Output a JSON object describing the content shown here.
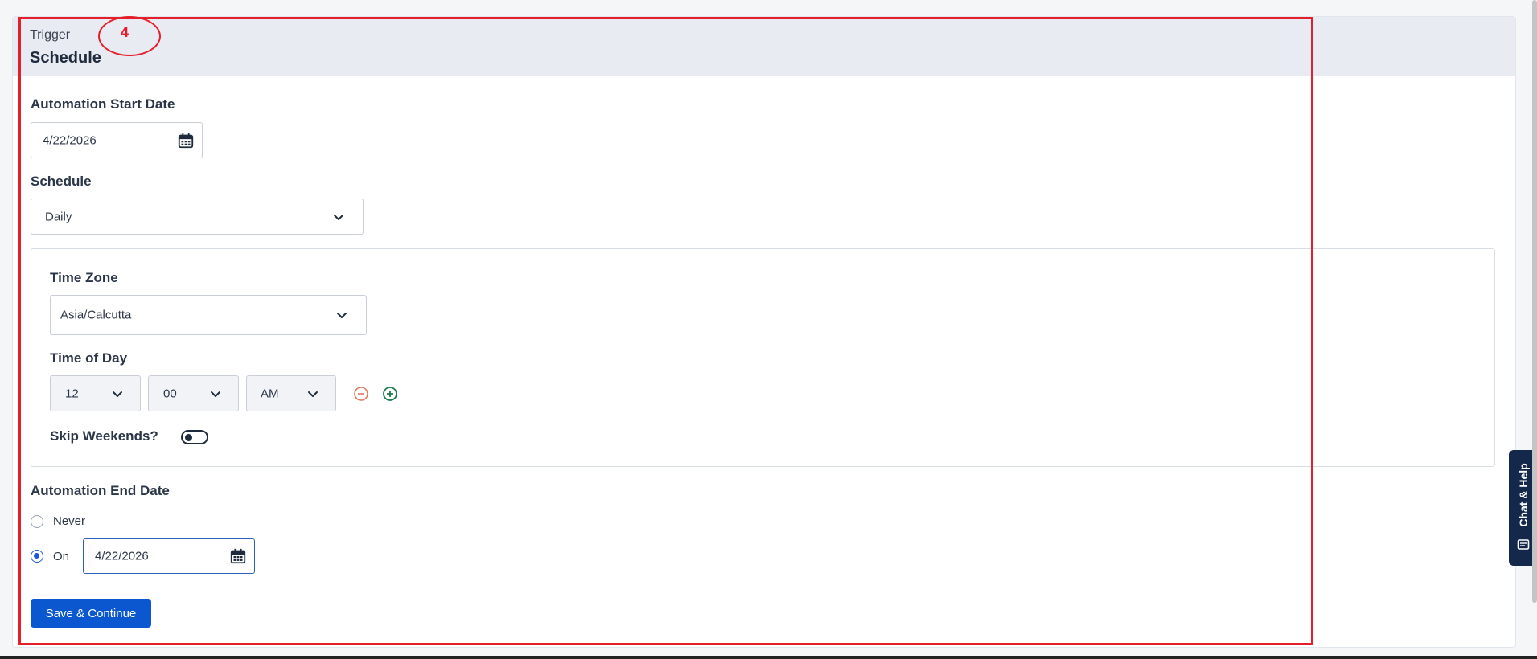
{
  "header": {
    "kicker": "Trigger",
    "title": "Schedule"
  },
  "start_date": {
    "label": "Automation Start Date",
    "value": "4/22/2026",
    "icon": "calendar-icon"
  },
  "schedule": {
    "label": "Schedule",
    "value": "Daily",
    "icon": "chevron-down-icon"
  },
  "time_zone": {
    "label": "Time Zone",
    "value": "Asia/Calcutta"
  },
  "time_of_day": {
    "label": "Time of Day",
    "hour": "12",
    "minute": "00",
    "ampm": "AM",
    "remove_icon": "minus-circle-icon",
    "add_icon": "plus-circle-icon"
  },
  "skip_weekends": {
    "label": "Skip Weekends?",
    "enabled": false
  },
  "end_date": {
    "label": "Automation End Date",
    "options": [
      {
        "label": "Never",
        "selected": false
      },
      {
        "label": "On",
        "selected": true
      }
    ],
    "value": "4/22/2026"
  },
  "actions": {
    "save_label": "Save & Continue"
  },
  "annotation": {
    "number": "4",
    "color": "#e41f2a"
  },
  "chat": {
    "label": "Chat & Help"
  },
  "colors": {
    "primary": "#0b57d0",
    "header_bg": "#e8ebf2",
    "remove": "#e07a5f",
    "add": "#1e7b4f"
  }
}
